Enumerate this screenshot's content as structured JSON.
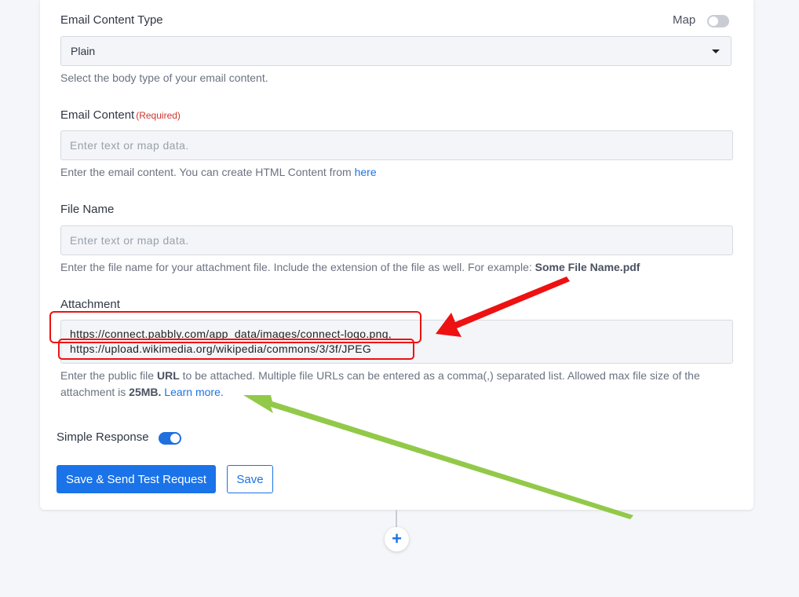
{
  "email_content_type": {
    "label": "Email Content Type",
    "map_label": "Map",
    "selected": "Plain",
    "help": "Select the body type of your email content."
  },
  "email_content": {
    "label": "Email Content",
    "required": "(Required)",
    "placeholder": "Enter text or map data.",
    "help": "Enter the email content. You can create HTML Content from ",
    "help_link": "here"
  },
  "file_name": {
    "label": "File Name",
    "placeholder": "Enter text or map data.",
    "help": "Enter the file name for your attachment file. Include the extension of the file as well. For example: ",
    "help_example": "Some File Name.pdf"
  },
  "attachment": {
    "label": "Attachment",
    "line1": "https://connect.pabbly.com/app_data/images/connect-logo.png,",
    "line2": "https://upload.wikimedia.org/wikipedia/commons/3/3f/JPEG",
    "help_a": "Enter the public file ",
    "help_url": "URL",
    "help_b": " to be attached. Multiple file URLs can be entered as a comma(,) separated list. Allowed max file size of the attachment is ",
    "help_size": "25MB.",
    "help_link": "Learn more."
  },
  "simple_response": {
    "label": "Simple Response"
  },
  "buttons": {
    "save_send": "Save & Send Test Request",
    "save": "Save"
  },
  "add_step": {
    "symbol": "+"
  },
  "colors": {
    "accent": "#1a73e8",
    "annotation_red": "#ee1111",
    "annotation_green": "#8cc63f"
  }
}
